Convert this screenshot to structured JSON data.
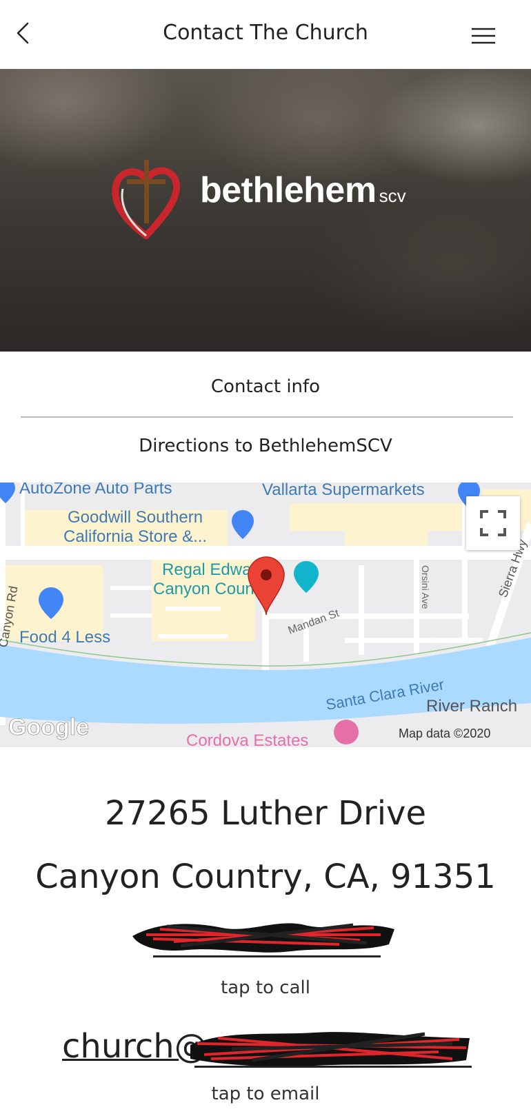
{
  "header": {
    "title": "Contact The Church",
    "back_icon": "chevron-left-icon",
    "menu_icon": "hamburger-menu-icon"
  },
  "hero": {
    "brand_name": "bethlehem",
    "brand_suffix": "scv",
    "logo_icon": "heart-cross-logo"
  },
  "tabs": {
    "contact_info": "Contact info",
    "directions": "Directions to BethlehemSCV"
  },
  "map": {
    "places": {
      "autozone": "AutoZone Auto Parts",
      "vallarta": "Vallarta Supermarkets",
      "goodwill_1": "Goodwill Southern",
      "goodwill_2": "California Store &...",
      "regal_1": "Regal Edwards",
      "regal_2": "Canyon Country",
      "food4less": "Food 4 Less",
      "cordova": "Cordova Estates",
      "river_ranch": "River Ranch"
    },
    "streets": {
      "mandan": "Mandan St",
      "orsini": "Orsini Ave",
      "sierra": "Sierra Hwy",
      "canyon_rd": "Canyon Rd"
    },
    "river": "Santa Clara River",
    "attribution": "Map data ©2020",
    "provider_logo": "Google",
    "marker_icon": "map-pin-icon",
    "fullscreen_icon": "fullscreen-icon",
    "colors": {
      "water": "#aadaff",
      "road": "#ffffff",
      "block": "#fef6d3",
      "label": "#3e7ab6",
      "marker": "#ea4335"
    }
  },
  "contact": {
    "address_line1": "27265 Luther Drive",
    "address_line2": "Canyon Country, CA, 91351",
    "call_hint": "tap to call",
    "email_prefix": "church@",
    "email_hint": "tap to email"
  }
}
